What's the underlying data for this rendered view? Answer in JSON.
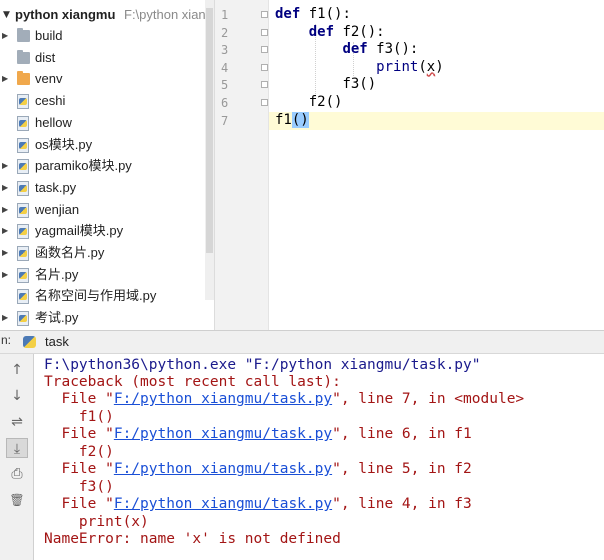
{
  "project": {
    "root_name": "python xiangmu",
    "root_path": "F:\\python xiang",
    "items": [
      {
        "label": "build",
        "type": "folder",
        "expandable": true
      },
      {
        "label": "dist",
        "type": "folder",
        "expandable": false
      },
      {
        "label": "venv",
        "type": "venv",
        "expandable": true
      },
      {
        "label": "ceshi",
        "type": "pkg",
        "expandable": false
      },
      {
        "label": "hellow",
        "type": "pkg",
        "expandable": false
      },
      {
        "label": "os模块.py",
        "type": "pyfile",
        "expandable": false
      },
      {
        "label": "paramiko模块.py",
        "type": "pyfile",
        "expandable": true
      },
      {
        "label": "task.py",
        "type": "pyfile",
        "expandable": true
      },
      {
        "label": "wenjian",
        "type": "pkg",
        "expandable": true
      },
      {
        "label": "yagmail模块.py",
        "type": "pyfile",
        "expandable": true
      },
      {
        "label": "函数名片.py",
        "type": "pyfile",
        "expandable": true
      },
      {
        "label": "名片.py",
        "type": "pyfile",
        "expandable": true
      },
      {
        "label": "名称空间与作用域.py",
        "type": "pyfile",
        "expandable": false
      },
      {
        "label": "考试.py",
        "type": "pyfile",
        "expandable": true
      }
    ]
  },
  "editor": {
    "line_numbers": [
      "1",
      "2",
      "3",
      "4",
      "5",
      "6",
      "7"
    ],
    "current_line": 7,
    "lines": [
      {
        "kw": "def",
        "rest": " f1():",
        "indent": ""
      },
      {
        "kw": "def",
        "rest": " f2():",
        "indent": "    "
      },
      {
        "kw": "def",
        "rest": " f3():",
        "indent": "        "
      },
      {
        "builtin": "print",
        "open": "(",
        "arg": "x",
        "close": ")",
        "indent": "            "
      },
      {
        "text": "f3()",
        "indent": "        "
      },
      {
        "text": "f2()",
        "indent": "    "
      },
      {
        "name": "f1",
        "brace": "()",
        "indent": ""
      }
    ]
  },
  "run": {
    "prefix": "n:",
    "tab_label": "task",
    "toolbar": {
      "up": "↑",
      "down": "↓",
      "wrap": "⇌",
      "scroll_end": "⤓",
      "print": "⎙",
      "delete": "🗑"
    },
    "console": {
      "command": "F:\\python36\\python.exe \"F:/python xiangmu/task.py\"",
      "traceback": "Traceback (most recent call last):",
      "frames": [
        {
          "pre": "  File \"",
          "file": "F:/python xiangmu/task.py",
          "post": "\", line 7, in <module>",
          "code": "    f1()"
        },
        {
          "pre": "  File \"",
          "file": "F:/python xiangmu/task.py",
          "post": "\", line 6, in f1",
          "code": "    f2()"
        },
        {
          "pre": "  File \"",
          "file": "F:/python xiangmu/task.py",
          "post": "\", line 5, in f2",
          "code": "    f3()"
        },
        {
          "pre": "  File \"",
          "file": "F:/python xiangmu/task.py",
          "post": "\", line 4, in f3",
          "code": "    print(x)"
        }
      ],
      "error": "NameError: name 'x' is not defined"
    }
  },
  "colors": {
    "keyword": "#000080",
    "error": "#a31515",
    "link": "#1a4fd6",
    "current_line": "#fffbd6",
    "brace_match": "#99ccff"
  }
}
